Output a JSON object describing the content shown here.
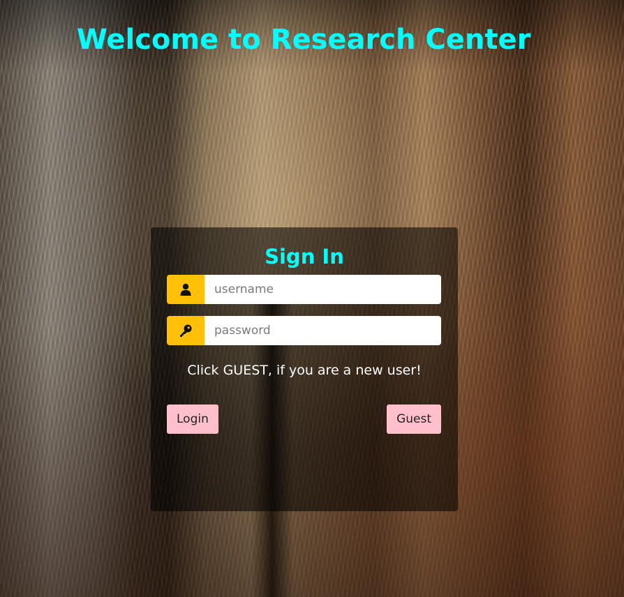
{
  "page": {
    "title": "Welcome to Research Center"
  },
  "signin": {
    "heading": "Sign In",
    "username": {
      "placeholder": "username",
      "value": "",
      "icon": "user-icon"
    },
    "password": {
      "placeholder": "password",
      "value": "",
      "icon": "key-icon"
    },
    "hint": "Click GUEST, if you are a new user!",
    "login_label": "Login",
    "guest_label": "Guest"
  },
  "colors": {
    "title": "#00ffff",
    "icon_background": "#ffc107",
    "button_background": "#ffc0cb",
    "card_background": "rgba(0,0,0,0.55)"
  }
}
